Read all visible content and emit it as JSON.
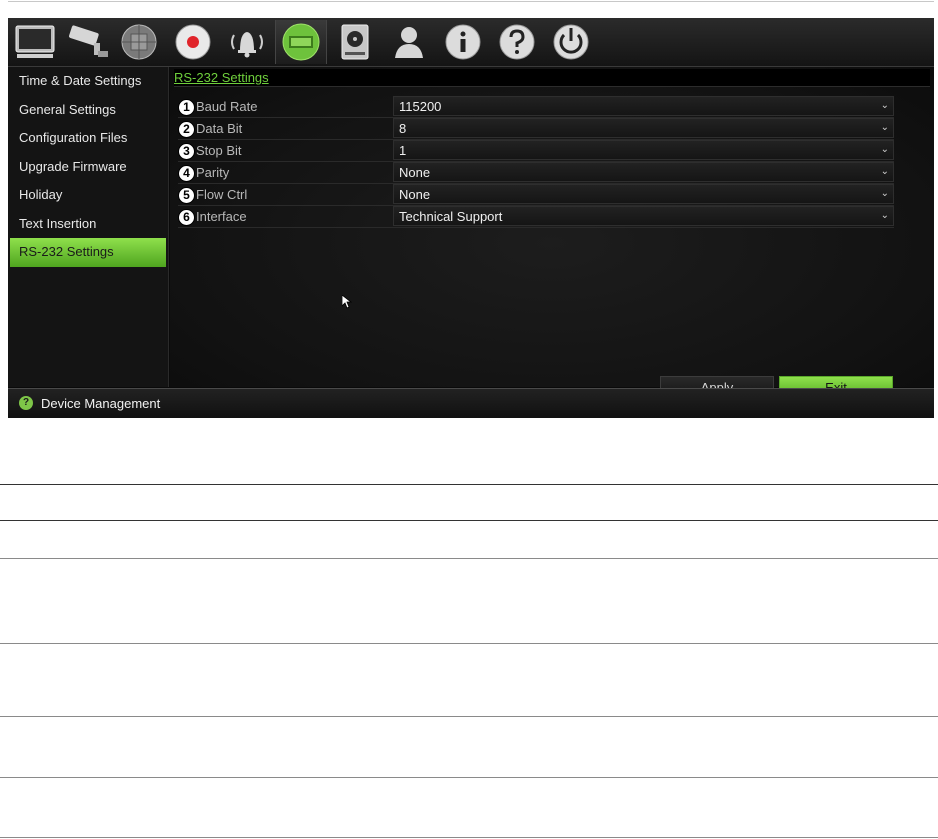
{
  "icons": [
    {
      "name": "monitor-icon"
    },
    {
      "name": "camera-icon"
    },
    {
      "name": "network-icon"
    },
    {
      "name": "record-icon"
    },
    {
      "name": "alarm-icon"
    },
    {
      "name": "device-management-icon"
    },
    {
      "name": "hdd-icon"
    },
    {
      "name": "user-icon"
    },
    {
      "name": "info-icon"
    },
    {
      "name": "help-icon"
    },
    {
      "name": "power-icon"
    }
  ],
  "sidebar": {
    "items": [
      {
        "label": "Time & Date Settings",
        "active": false
      },
      {
        "label": "General Settings",
        "active": false
      },
      {
        "label": "Configuration Files",
        "active": false
      },
      {
        "label": "Upgrade Firmware",
        "active": false
      },
      {
        "label": "Holiday",
        "active": false
      },
      {
        "label": "Text Insertion",
        "active": false
      },
      {
        "label": "RS-232 Settings",
        "active": true
      }
    ]
  },
  "content": {
    "title": "RS-232 Settings",
    "fields": [
      {
        "num": "1",
        "label": "Baud Rate",
        "value": "115200"
      },
      {
        "num": "2",
        "label": "Data Bit",
        "value": "8"
      },
      {
        "num": "3",
        "label": "Stop Bit",
        "value": "1"
      },
      {
        "num": "4",
        "label": "Parity",
        "value": "None"
      },
      {
        "num": "5",
        "label": "Flow Ctrl",
        "value": "None"
      },
      {
        "num": "6",
        "label": "Interface",
        "value": "Technical Support"
      }
    ],
    "apply_label": "Apply",
    "exit_label": "Exit"
  },
  "status": {
    "text": "Device Management"
  },
  "colors": {
    "accent": "#6fcf3c",
    "active_green": "#4fa51f",
    "background": "#0a0a0a"
  }
}
